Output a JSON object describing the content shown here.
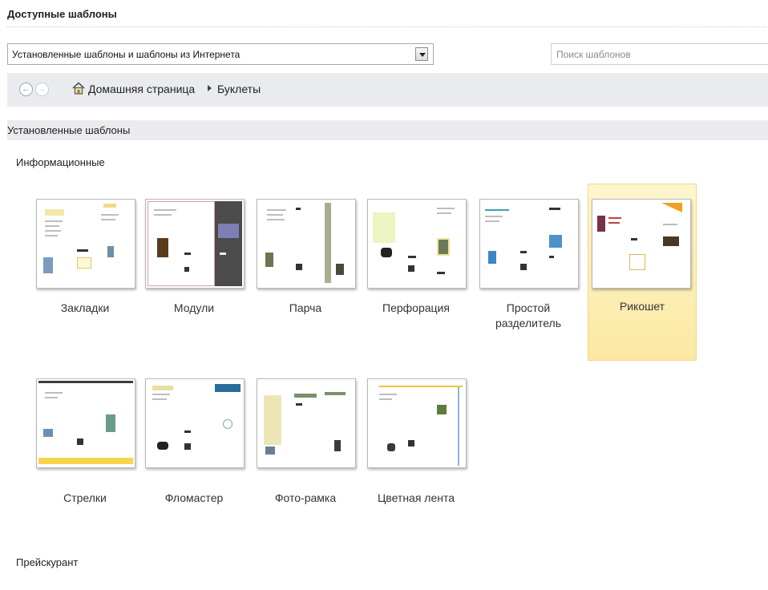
{
  "header": {
    "title": "Доступные шаблоны"
  },
  "filter": {
    "selected": "Установленные шаблоны и шаблоны из Интернета"
  },
  "search": {
    "placeholder": "Поиск шаблонов"
  },
  "nav": {
    "home": "Домашняя страница",
    "current": "Буклеты"
  },
  "section": {
    "title": "Установленные шаблоны"
  },
  "categories": {
    "info": "Информационные",
    "price": "Прейскурант"
  },
  "templates": [
    {
      "label": "Закладки"
    },
    {
      "label": "Модули"
    },
    {
      "label": "Парча"
    },
    {
      "label": "Перфорация"
    },
    {
      "label": "Простой разделитель"
    },
    {
      "label": "Рикошет",
      "selected": true
    },
    {
      "label": "Стрелки"
    },
    {
      "label": "Фломастер"
    },
    {
      "label": "Фото-рамка"
    },
    {
      "label": "Цветная лента"
    }
  ],
  "colors": {
    "selection": "#fbe8a3",
    "navbar": "#e9ebee"
  },
  "icons": {
    "back": "arrow-left-icon",
    "forward": "arrow-right-icon",
    "home": "home-icon",
    "dropdown": "chevron-down-icon"
  }
}
